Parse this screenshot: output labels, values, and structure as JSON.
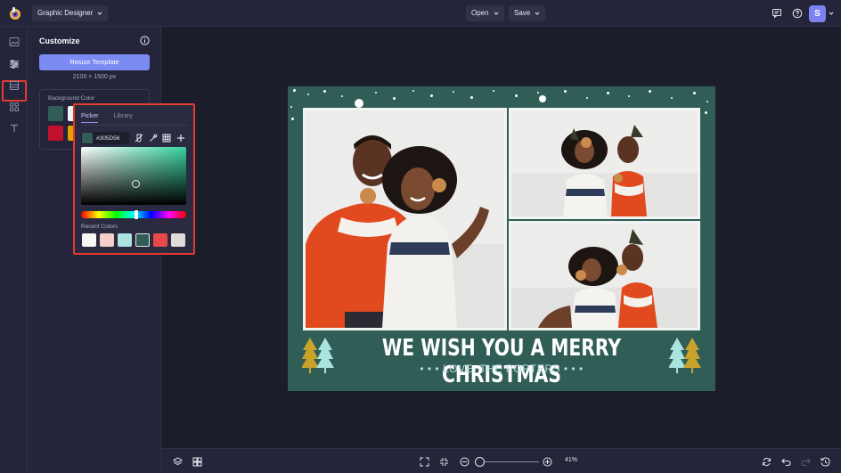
{
  "header": {
    "app_name": "Graphic Designer",
    "open_label": "Open",
    "save_label": "Save",
    "avatar_initial": "S"
  },
  "rail": {
    "items": [
      "image-icon",
      "sliders-icon",
      "layout-icon",
      "elements-icon",
      "text-icon"
    ],
    "active": "sliders-icon"
  },
  "panel": {
    "title": "Customize",
    "resize_label": "Resize Template",
    "size_text": "2100 × 1500 px",
    "background_label": "Background Color"
  },
  "picker": {
    "tabs": [
      "Picker",
      "Library"
    ],
    "active_tab": "Picker",
    "hex_value": "#305D56",
    "recent_label": "Recent Colors",
    "recent_colors": [
      "#f7f7f7",
      "#f6cfc8",
      "#a9e4df",
      "#305d56",
      "#e84a4a",
      "#e2dada"
    ],
    "hue_level": 0.48,
    "saturation": 0.55,
    "brightness": 0.37
  },
  "design": {
    "headline": "WE WISH YOU A MERRY CHRISTMAS",
    "subline": "• • •  LOVE, THE PORTERS  • • •",
    "background": "#305d56"
  },
  "zoom": {
    "level_text": "41%"
  },
  "colors": {
    "accent": "#7c8bf3",
    "highlight": "#e23b2e"
  }
}
